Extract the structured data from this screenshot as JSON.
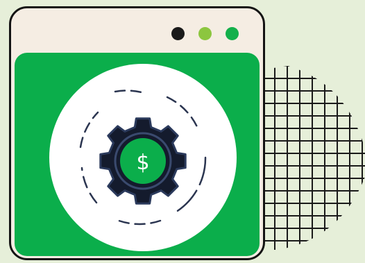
{
  "window": {
    "controls": [
      {
        "name": "control-dot-dark",
        "color": "#1a1a1a"
      },
      {
        "name": "control-dot-lime",
        "color": "#8cc63f"
      },
      {
        "name": "control-dot-green",
        "color": "#13b04b"
      }
    ]
  },
  "icon": {
    "name": "gear-dollar-icon",
    "symbol": "$"
  },
  "colors": {
    "background": "#e6efd9",
    "window_frame": "#f5ede3",
    "content_green": "#0bae4b",
    "gear": "#141b2d",
    "coin": "#0bae4b",
    "circle_white": "#ffffff"
  }
}
